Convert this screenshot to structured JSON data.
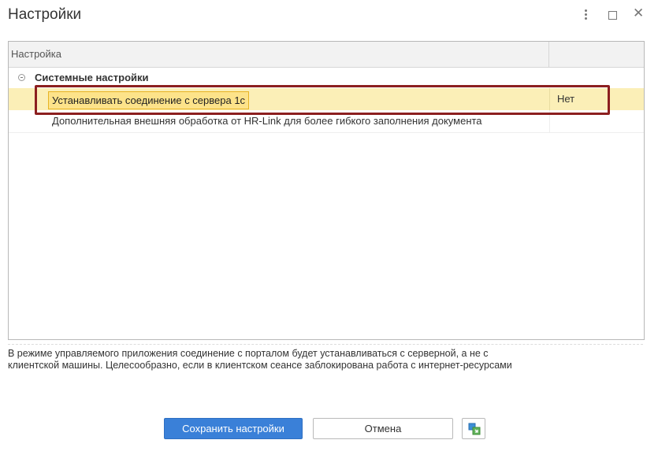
{
  "window": {
    "title": "Настройки"
  },
  "table": {
    "columns": [
      "Настройка",
      ""
    ],
    "group": {
      "label": "Системные настройки",
      "expanded": true
    },
    "rows": [
      {
        "setting": "Устанавливать соединение с сервера 1с",
        "value": "Нет",
        "selected": true
      },
      {
        "setting": "Дополнительная внешняя обработка от HR-Link для более гибкого заполнения документа",
        "value": ""
      }
    ]
  },
  "description": {
    "line1": "В режиме управляемого приложения соединение с порталом будет устанавливаться с серверной, а не с",
    "line2": "клиентской машины. Целесообразно, если в клиентском сеансе заблокирована работа с интернет-ресурсами"
  },
  "buttons": {
    "save_label": "Сохранить настройки",
    "cancel_label": "Отмена",
    "extra_icon": "copy-settings-icon"
  },
  "colors": {
    "primary": "#3a80d8",
    "selection_row": "#fbefb7",
    "selection_cell": "#fde38a",
    "highlight_frame": "#8c1f1f"
  }
}
